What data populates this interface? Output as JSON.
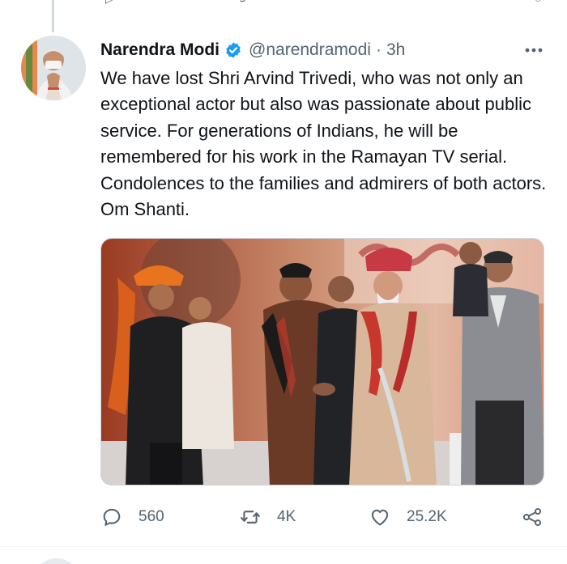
{
  "tweet": {
    "author": {
      "display_name": "Narendra Modi",
      "verified": true,
      "handle": "@narendramodi"
    },
    "separator": "·",
    "time": "3h",
    "text": "We have lost Shri Arvind Trivedi, who was not only an exceptional actor but also was passionate about public service. For generations of Indians, he will be remembered for his work in the Ramayan TV serial. Condolences to the families and admirers of both actors. Om Shanti.",
    "more_icon": "more-horizontal-icon",
    "media": {
      "type": "photo",
      "banner_text": ""
    },
    "actions": {
      "reply": {
        "icon": "reply-icon",
        "count": "560"
      },
      "retweet": {
        "icon": "retweet-icon",
        "count": "4K"
      },
      "like": {
        "icon": "heart-icon",
        "count": "25.2K"
      },
      "share": {
        "icon": "share-icon"
      }
    }
  },
  "colors": {
    "text_primary": "#0f1419",
    "text_secondary": "#536471",
    "verified_blue": "#1d9bf0",
    "border": "#cfd9de"
  }
}
